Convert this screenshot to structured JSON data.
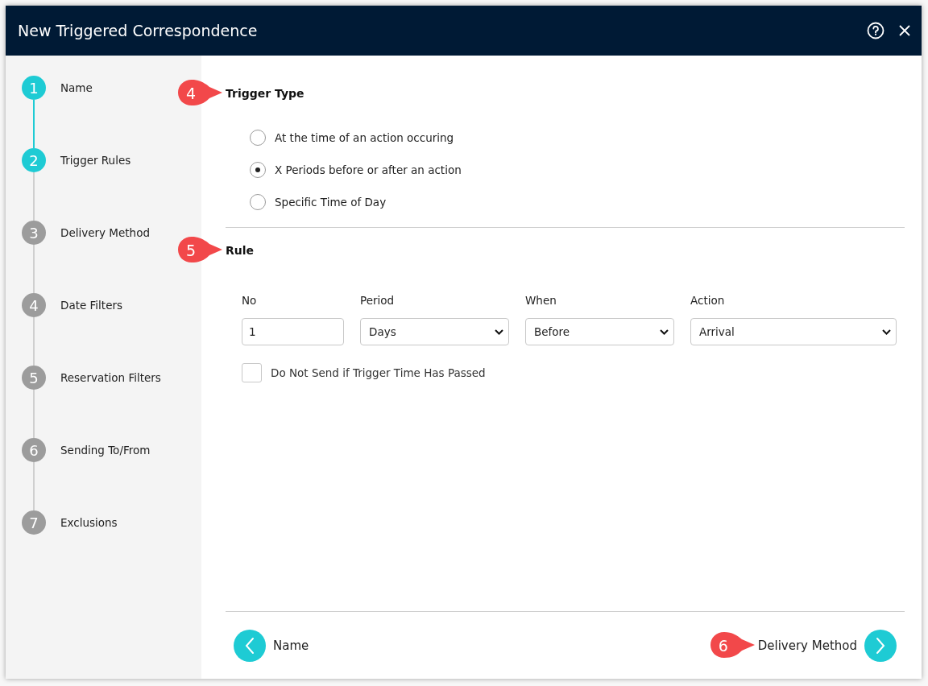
{
  "window": {
    "title": "New Triggered Correspondence"
  },
  "steps": [
    {
      "number": "1",
      "label": "Name",
      "reached": true
    },
    {
      "number": "2",
      "label": "Trigger Rules",
      "reached": true
    },
    {
      "number": "3",
      "label": "Delivery Method",
      "reached": false
    },
    {
      "number": "4",
      "label": "Date Filters",
      "reached": false
    },
    {
      "number": "5",
      "label": "Reservation Filters",
      "reached": false
    },
    {
      "number": "6",
      "label": "Sending To/From",
      "reached": false
    },
    {
      "number": "7",
      "label": "Exclusions",
      "reached": false
    }
  ],
  "trigger_type": {
    "heading": "Trigger Type",
    "callout": "4",
    "options": [
      {
        "label": "At the time of an action occuring",
        "selected": false
      },
      {
        "label": "X Periods before or after an action",
        "selected": true
      },
      {
        "label": "Specific Time of Day",
        "selected": false
      }
    ]
  },
  "rule": {
    "heading": "Rule",
    "callout": "5",
    "fields": [
      {
        "kind": "input",
        "label": "No",
        "value": "1"
      },
      {
        "kind": "select",
        "label": "Period",
        "value": "Days"
      },
      {
        "kind": "select",
        "label": "When",
        "value": "Before"
      },
      {
        "kind": "select",
        "label": "Action",
        "value": "Arrival"
      }
    ],
    "checkbox": {
      "label": "Do Not Send if Trigger Time Has Passed",
      "checked": false
    }
  },
  "footer": {
    "back": {
      "label": "Name"
    },
    "next": {
      "label": "Delivery Method",
      "callout": "6"
    }
  }
}
